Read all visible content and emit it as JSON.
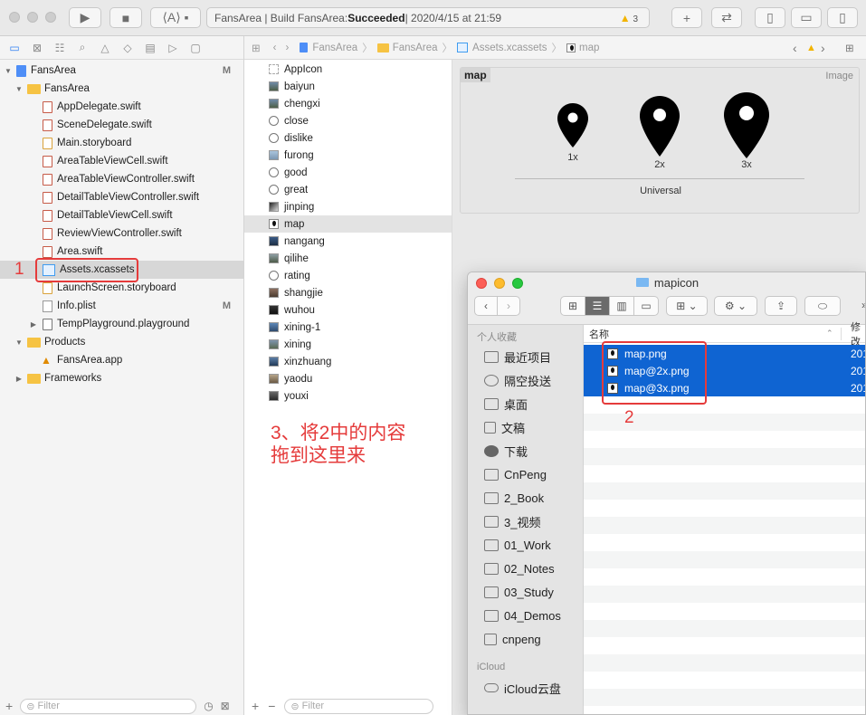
{
  "toolbar": {
    "scheme_icon": "scheme-icon",
    "status_prefix": "FansArea | Build FansArea: ",
    "status_result": "Succeeded",
    "status_time": " | 2020/4/15 at 21:59",
    "warning_count": "3"
  },
  "navigator": {
    "items": [
      {
        "label": "FansArea",
        "badge": "M"
      },
      {
        "label": "FansArea"
      },
      {
        "label": "AppDelegate.swift"
      },
      {
        "label": "SceneDelegate.swift"
      },
      {
        "label": "Main.storyboard"
      },
      {
        "label": "AreaTableViewCell.swift"
      },
      {
        "label": "AreaTableViewController.swift"
      },
      {
        "label": "DetailTableViewController.swift"
      },
      {
        "label": "DetailTableViewCell.swift"
      },
      {
        "label": "ReviewViewController.swift"
      },
      {
        "label": "Area.swift"
      },
      {
        "label": "Assets.xcassets"
      },
      {
        "label": "LaunchScreen.storyboard"
      },
      {
        "label": "Info.plist",
        "badge": "M"
      },
      {
        "label": "TempPlayground.playground"
      },
      {
        "label": "Products"
      },
      {
        "label": "FansArea.app"
      },
      {
        "label": "Frameworks"
      }
    ],
    "filter_placeholder": "Filter"
  },
  "jumpbar": {
    "crumbs": [
      "FansArea",
      "FansArea",
      "Assets.xcassets",
      "map"
    ]
  },
  "asset_list": {
    "items": [
      "AppIcon",
      "baiyun",
      "chengxi",
      "close",
      "dislike",
      "furong",
      "good",
      "great",
      "jinping",
      "map",
      "nangang",
      "qilihe",
      "rating",
      "shangjie",
      "wuhou",
      "xining-1",
      "xining",
      "xinzhuang",
      "yaodu",
      "youxi"
    ],
    "filter_placeholder": "Filter"
  },
  "editor": {
    "set_name": "map",
    "set_type": "Image",
    "slots": [
      "1x",
      "2x",
      "3x"
    ],
    "device": "Universal"
  },
  "annotations": {
    "step1": "1",
    "step2": "2",
    "step3_line1": "3、将2中的内容",
    "step3_line2": "拖到这里来"
  },
  "finder": {
    "title": "mapicon",
    "sidebar_header": "个人收藏",
    "sidebar_items": [
      "最近项目",
      "隔空投送",
      "桌面",
      "文稿",
      "下载",
      "CnPeng",
      "2_Book",
      "3_视频",
      "01_Work",
      "02_Notes",
      "03_Study",
      "04_Demos",
      "cnpeng"
    ],
    "icloud_header": "iCloud",
    "icloud_item": "iCloud云盘",
    "col_name": "名称",
    "col_modified": "修改",
    "files": [
      {
        "name": "map.png",
        "date": "201"
      },
      {
        "name": "map@2x.png",
        "date": "201"
      },
      {
        "name": "map@3x.png",
        "date": "201"
      }
    ]
  }
}
